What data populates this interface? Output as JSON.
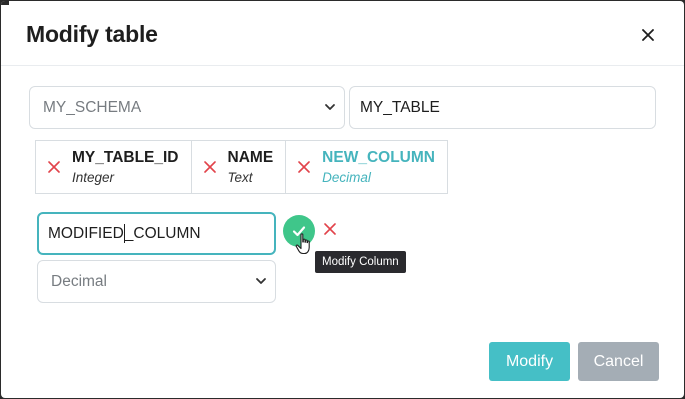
{
  "dialog": {
    "title": "Modify table"
  },
  "form": {
    "schema_value": "MY_SCHEMA",
    "table_name_value": "MY_TABLE"
  },
  "columns": [
    {
      "name": "MY_TABLE_ID",
      "type": "Integer",
      "active": false
    },
    {
      "name": "NAME",
      "type": "Text",
      "active": false
    },
    {
      "name": "NEW_COLUMN",
      "type": "Decimal",
      "active": true
    }
  ],
  "edit": {
    "name_before_caret": "MODIFIED",
    "name_after_caret": "_COLUMN",
    "type_value": "Decimal",
    "tooltip": "Modify Column"
  },
  "footer": {
    "modify_label": "Modify",
    "cancel_label": "Cancel"
  },
  "colors": {
    "accent": "#45b4bd",
    "confirm_green": "#3fc68a",
    "remove_red": "#e2434b",
    "cancel_gray": "#a4adb5"
  },
  "icons": {
    "close": "close-icon",
    "remove": "remove-x-icon",
    "confirm": "checkmark-icon",
    "dropdown": "chevron-down-icon",
    "cursor": "hand-pointer-icon"
  }
}
